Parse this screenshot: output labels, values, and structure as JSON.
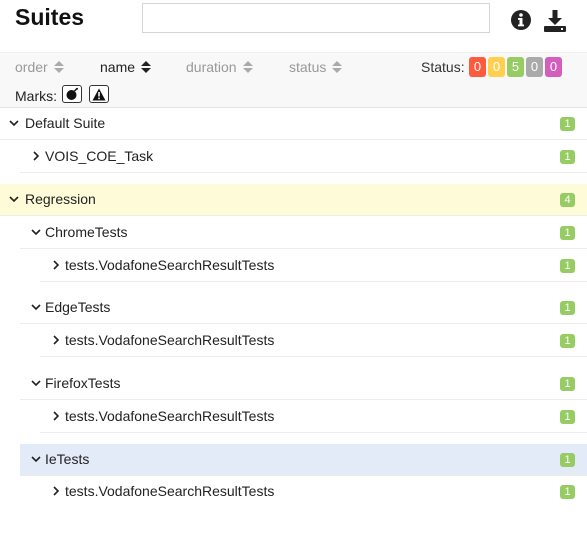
{
  "header": {
    "title": "Suites",
    "search_value": "",
    "info_icon": "info-icon",
    "download_icon": "download-icon"
  },
  "sort": {
    "order": "order",
    "name": "name",
    "duration": "duration",
    "status": "status",
    "active": "name"
  },
  "status": {
    "label": "Status:",
    "counters": [
      {
        "value": "0",
        "color": "#fd5a3e"
      },
      {
        "value": "0",
        "color": "#ffd050"
      },
      {
        "value": "5",
        "color": "#97cc64"
      },
      {
        "value": "0",
        "color": "#aaaaaa"
      },
      {
        "value": "0",
        "color": "#d35ebe"
      }
    ]
  },
  "marks": {
    "label": "Marks:",
    "items": [
      "bomb-icon",
      "warning-icon"
    ]
  },
  "tree": [
    {
      "label": "Default Suite",
      "count": "1",
      "expanded": true
    },
    {
      "label": "VOIS_COE_Task",
      "count": "1",
      "expanded": false
    },
    {
      "label": "Regression",
      "count": "4",
      "expanded": true
    },
    {
      "label": "ChromeTests",
      "count": "1",
      "expanded": true
    },
    {
      "label": "tests.VodafoneSearchResultTests",
      "count": "1",
      "expanded": false
    },
    {
      "label": "EdgeTests",
      "count": "1",
      "expanded": true
    },
    {
      "label": "tests.VodafoneSearchResultTests",
      "count": "1",
      "expanded": false
    },
    {
      "label": "FirefoxTests",
      "count": "1",
      "expanded": true
    },
    {
      "label": "tests.VodafoneSearchResultTests",
      "count": "1",
      "expanded": false
    },
    {
      "label": "IeTests",
      "count": "1",
      "expanded": true
    },
    {
      "label": "tests.VodafoneSearchResultTests",
      "count": "1",
      "expanded": false
    }
  ],
  "colors": {
    "badge_passed": "#97cc64",
    "highlight_yellow": "#fefbd8",
    "highlight_blue": "#e4ebf8"
  }
}
